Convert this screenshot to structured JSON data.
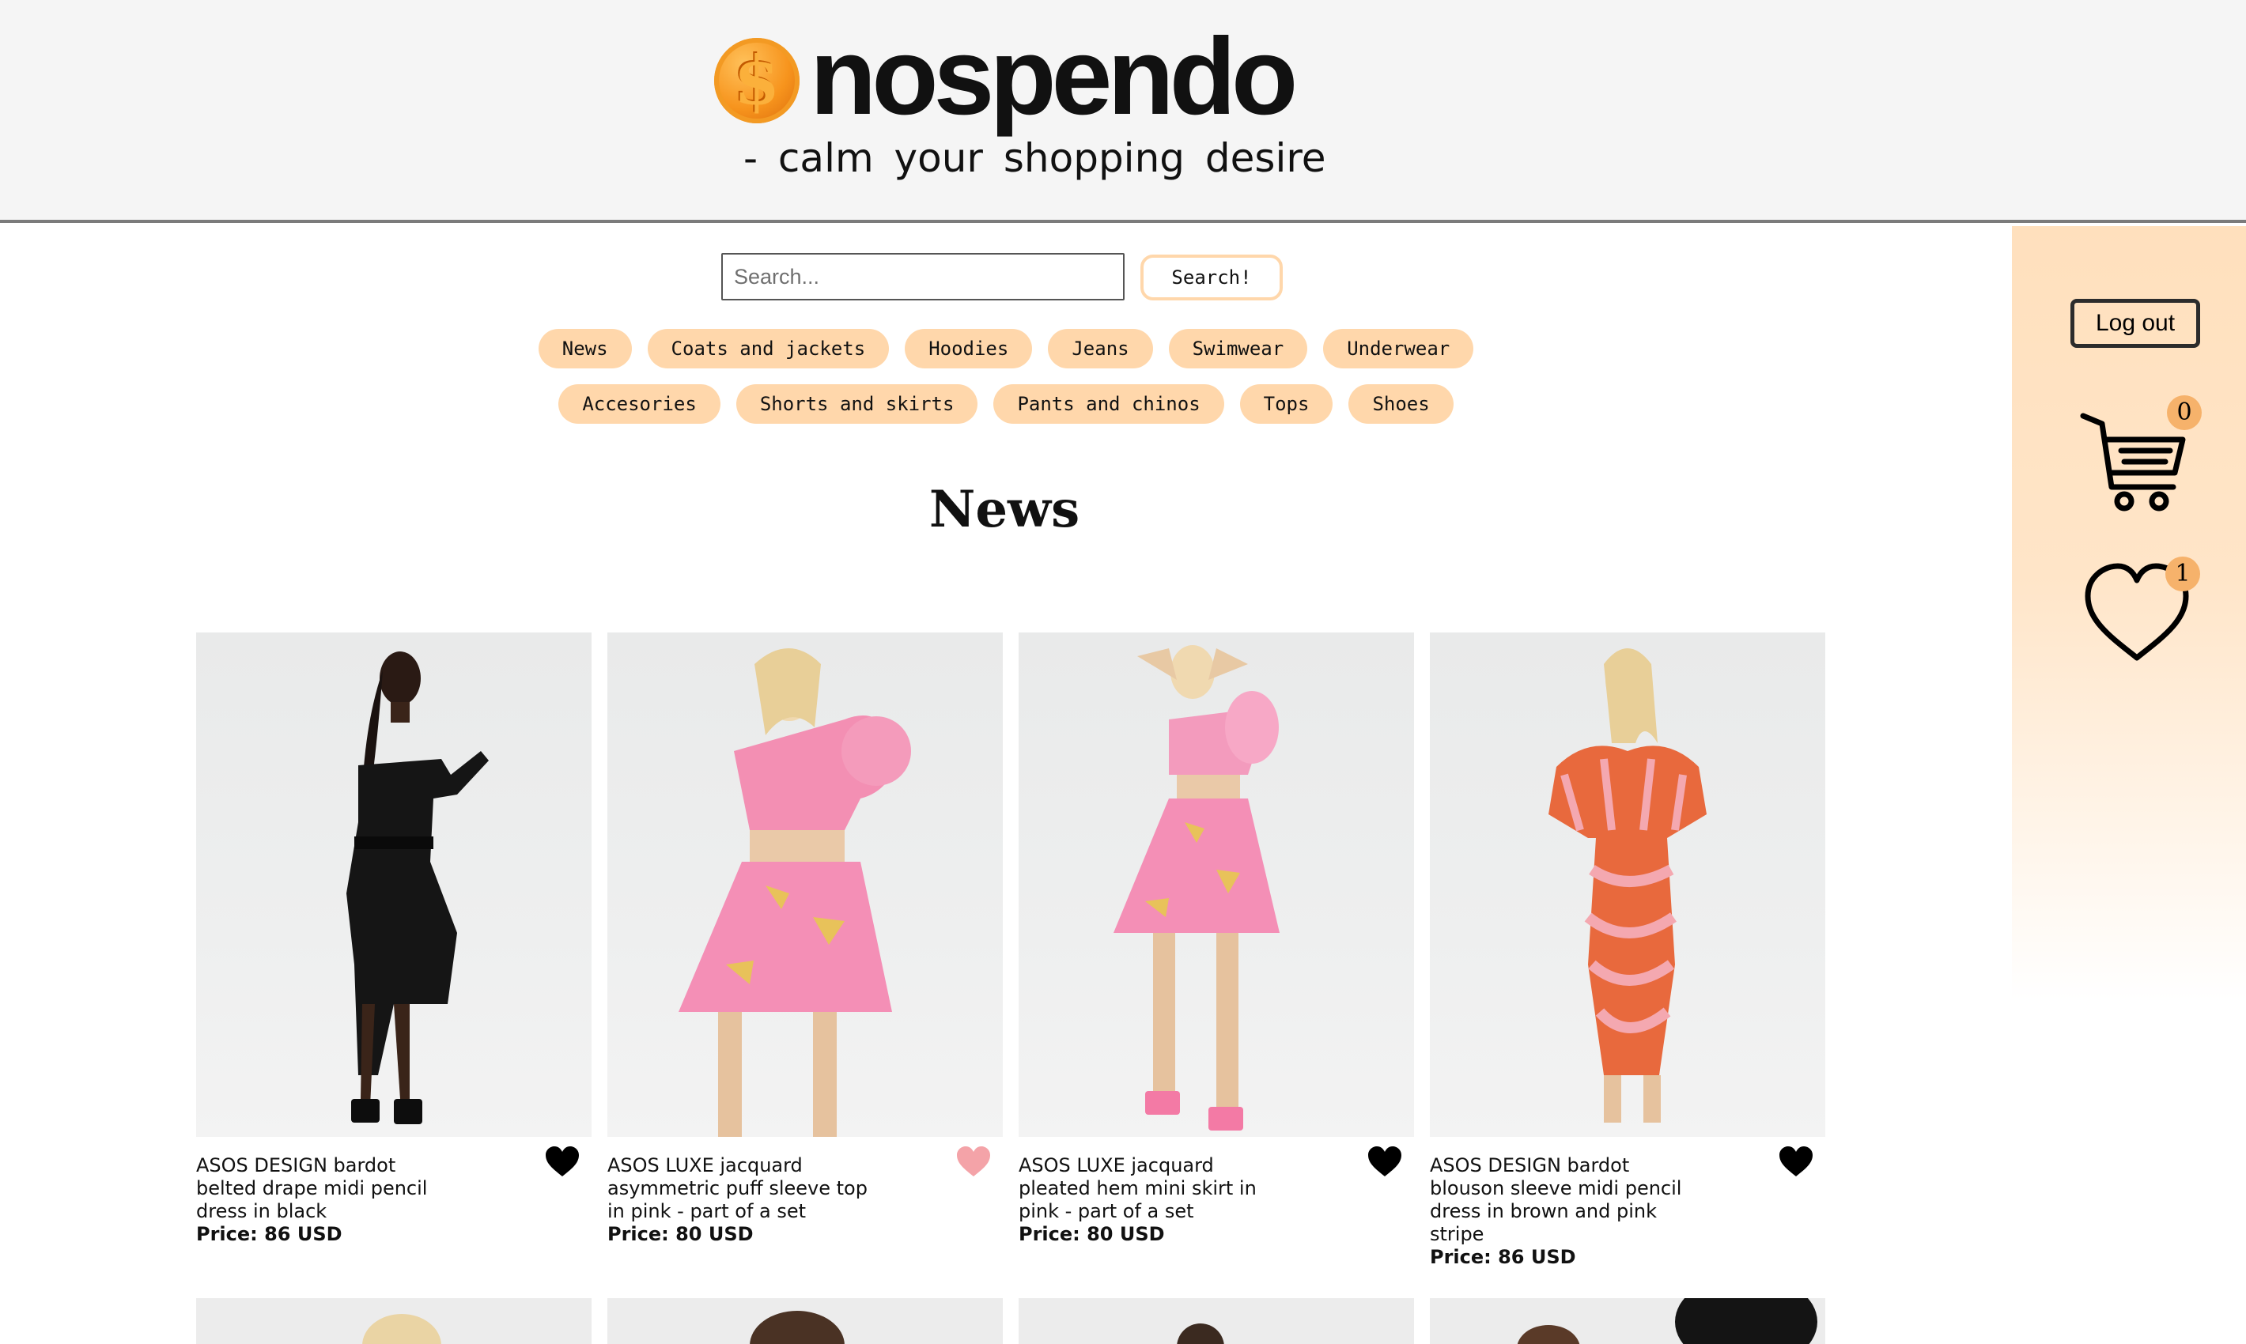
{
  "header": {
    "logo_text": "nospendo",
    "coin_symbol": "$",
    "tagline": "- calm your shopping desire"
  },
  "search": {
    "placeholder": "Search...",
    "value": "",
    "button_label": "Search!"
  },
  "categories": {
    "row1": [
      "News",
      "Coats and jackets",
      "Hoodies",
      "Jeans",
      "Swimwear",
      "Underwear"
    ],
    "row2": [
      "Accesories",
      "Shorts and skirts",
      "Pants and chinos",
      "Tops",
      "Shoes"
    ]
  },
  "section_title": "News",
  "sidebar": {
    "logout_label": "Log out",
    "cart_count": "0",
    "favorites_count": "1"
  },
  "products": [
    {
      "name": "ASOS DESIGN bardot belted drape midi pencil dress in black",
      "price": "Price: 86 USD",
      "favorited": true
    },
    {
      "name": "ASOS LUXE jacquard asymmetric puff sleeve top in pink - part of a set",
      "price": "Price: 80 USD",
      "favorited": false
    },
    {
      "name": "ASOS LUXE jacquard pleated hem mini skirt in pink - part of a set",
      "price": "Price: 80 USD",
      "favorited": true
    },
    {
      "name": "ASOS DESIGN bardot blouson sleeve midi pencil dress in brown and pink stripe",
      "price": "Price: 86 USD",
      "favorited": true
    }
  ],
  "colors": {
    "header_bg": "#f5f5f5",
    "chip_bg": "#ffd7ab",
    "sidebar_accent": "#ffe0bd",
    "badge": "#f6b26b",
    "heart_active": "#000000",
    "heart_inactive": "#f4a3a8"
  },
  "icons": {
    "logo": "dollar-coin-icon",
    "cart": "shopping-cart-icon",
    "favorites": "heart-outline-icon",
    "product_favorite": "heart-filled-icon"
  }
}
